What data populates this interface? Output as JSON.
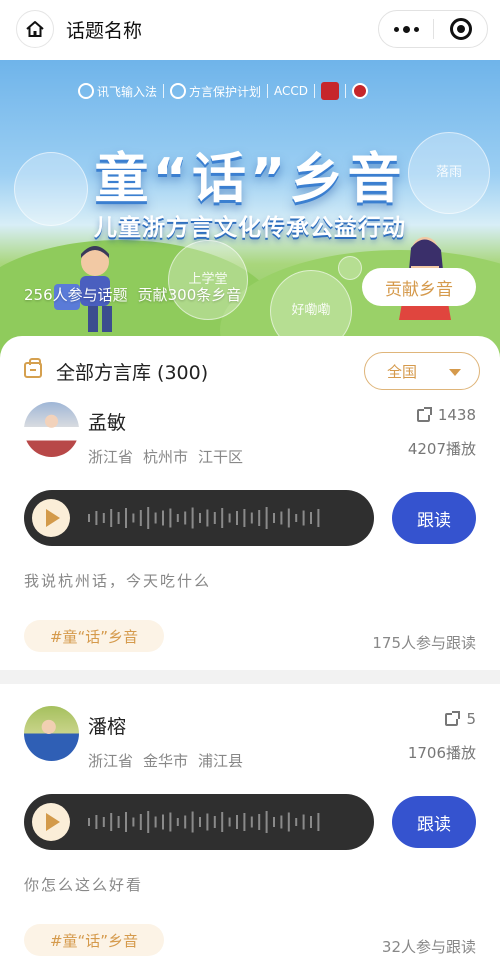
{
  "navbar": {
    "title": "话题名称",
    "home_icon": "home-icon",
    "more_icon": "more-dots-icon",
    "close_icon": "target-circle-icon"
  },
  "banner": {
    "logos": [
      "讯飞输入法",
      "方言保护计划",
      "ACCD"
    ],
    "title": "童“话”乡音",
    "subtitle": "儿童浙方言文化传承公益行动",
    "bubbles": [
      "落雨",
      "上学堂",
      "好嘞嘞"
    ],
    "stats": {
      "participants": "256人参与话题",
      "contributions": "贡献300条乡音"
    },
    "contribute_button": "贡献乡音"
  },
  "library": {
    "title": "全部方言库 (300)",
    "region_select": "全国"
  },
  "posts": [
    {
      "user": "孟敏",
      "location": [
        "浙江省",
        "杭州市",
        "江干区"
      ],
      "shares": "1438",
      "plays": "4207播放",
      "follow_button": "跟读",
      "text": "我说杭州话，今天吃什么",
      "topic": "#童“话”乡音",
      "join_count": "175人参与跟读"
    },
    {
      "user": "潘榕",
      "location": [
        "浙江省",
        "金华市",
        "浦江县"
      ],
      "shares": "5",
      "plays": "1706播放",
      "follow_button": "跟读",
      "text": "你怎么这么好看",
      "topic": "#童“话”乡音",
      "join_count": "32人参与跟读"
    }
  ],
  "colors": {
    "accent_gold": "#d59a4c",
    "follow_blue": "#3553cf",
    "player_dark": "#2f2f2f"
  }
}
